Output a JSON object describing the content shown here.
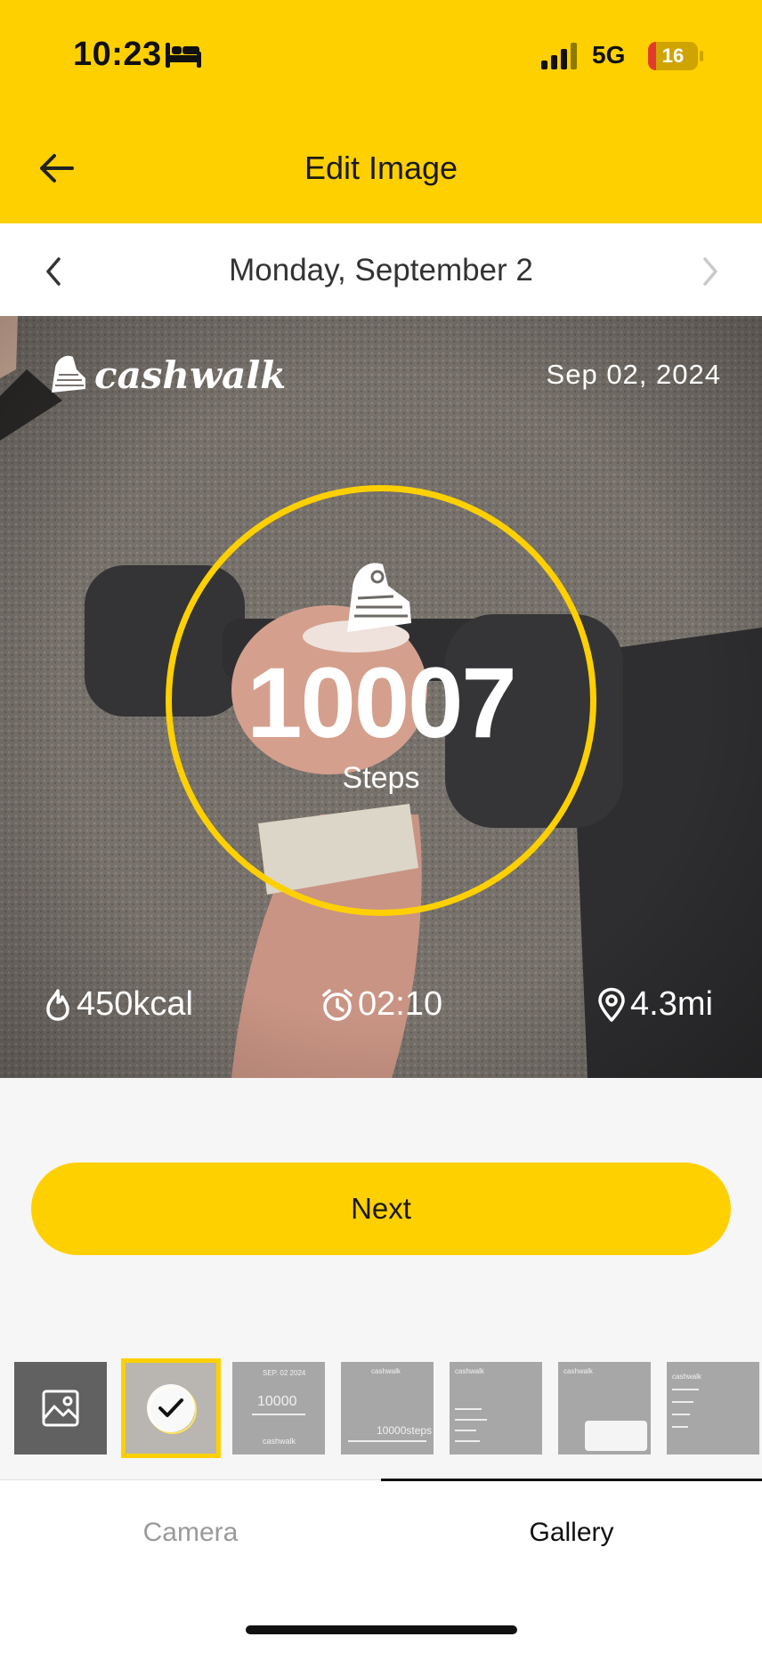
{
  "status_bar": {
    "time": "10:23",
    "network": "5G",
    "battery_percent": "16",
    "battery_level": 0.16,
    "icons": [
      "bed-icon",
      "signal-bars-icon",
      "battery-icon"
    ]
  },
  "header": {
    "title": "Edit Image",
    "back_icon": "arrow-left-icon"
  },
  "date_bar": {
    "label": "Monday, September 2",
    "prev_icon": "chevron-left-icon",
    "next_icon": "chevron-right-icon"
  },
  "card": {
    "brand": "cashwalk",
    "date": "Sep 02, 2024",
    "steps": "10007",
    "steps_label": "Steps",
    "calories": "450kcal",
    "duration": "02:10",
    "distance": "4.3mi",
    "icons": [
      "shoe-icon",
      "flame-icon",
      "alarm-clock-icon",
      "location-pin-icon"
    ]
  },
  "actions": {
    "next_label": "Next"
  },
  "templates": {
    "gallery_icon": "image-icon",
    "thumb3": {
      "top": "SEP. 02 2024",
      "steps": "10000",
      "brand": "cashwalk"
    },
    "thumb4": {
      "brand": "cashwalk",
      "steps": "10000steps"
    },
    "thumb5": {
      "brand": "cashwalk"
    },
    "thumb6": {
      "brand": "cashwalk"
    },
    "thumb7": {
      "brand": "cashwalk"
    }
  },
  "tabs": {
    "camera": "Camera",
    "gallery": "Gallery",
    "active": "Gallery"
  },
  "colors": {
    "accent": "#ffd000",
    "background": "#f6f6f6",
    "tab_inactive": "#9a9a9a"
  }
}
